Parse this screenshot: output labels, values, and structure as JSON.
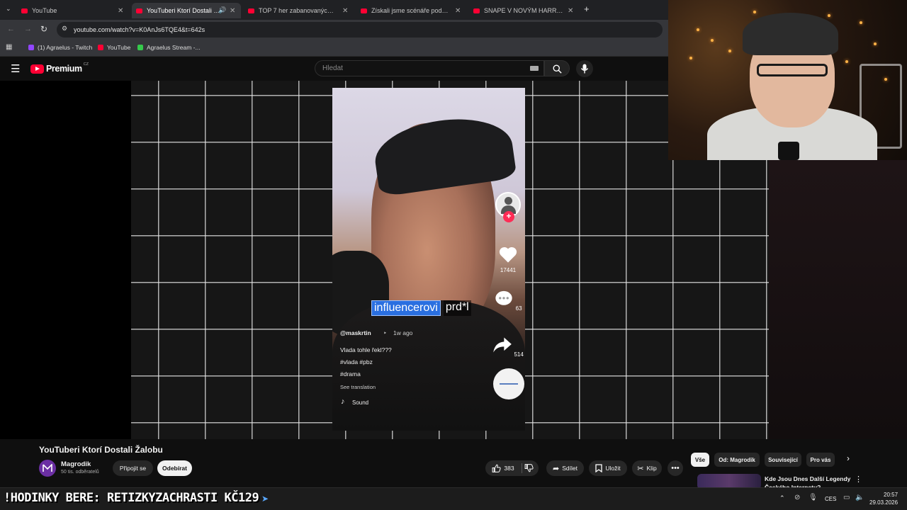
{
  "browser": {
    "tabs": [
      {
        "label": "YouTube",
        "active": false
      },
      {
        "label": "YouTuberi Ktorí Dostali Žalobu",
        "active": true
      },
      {
        "label": "TOP 7 her zabanovaných na Steamu",
        "active": false
      },
      {
        "label": "Získali jsme scénáře podvodníků",
        "active": false
      },
      {
        "label": "SNAPE V NOVÝM HARRY POTTEROVI",
        "active": false
      }
    ],
    "new_tab": "+",
    "url": "youtube.com/watch?v=K0AnJs6TQE4&t=642s",
    "bookmarks": [
      {
        "label": "(1) Agraelus - Twitch",
        "color": "#9146ff"
      },
      {
        "label": "YouTube",
        "color": "#ff0033"
      },
      {
        "label": "Agraelus Stream -...",
        "color": "#35c94b"
      }
    ]
  },
  "youtube": {
    "logo_text": "Premium",
    "logo_region": "CZ",
    "search_placeholder": "Hledat",
    "video": {
      "title": "YouTuberi Ktorí Dostali Žalobu",
      "channel": "Magrodik",
      "subscribers": "50 tis. odběratelů",
      "join_label": "Připojit se",
      "subscribe_label": "Odebírat",
      "likes": "383",
      "share_label": "Sdílet",
      "save_label": "Uložit",
      "clip_label": "Klip"
    },
    "chips": [
      "Vše",
      "Od: Magrodik",
      "Související",
      "Pro vás"
    ],
    "recommended_title": "Kde Jsou Dnes Další Legendy Českého Internetu?"
  },
  "tiktok": {
    "likes": "17441",
    "comments": "63",
    "shares": "514",
    "subtitle_highlight": "influencerovi",
    "subtitle_rest": "prd*l",
    "username": "@maskrtin",
    "posted": "1w ago",
    "caption": "Vlada tohle řekl???",
    "tags1": "#vlada #pbz",
    "tags2": "#drama",
    "see_translation": "See translation",
    "sound": "Sound"
  },
  "overlay": {
    "ticker": "!HODINKY BERE: RETIZKYZACHRASTI KČ129"
  },
  "taskbar": {
    "language": "CES",
    "time": "20:57",
    "date": "29.03.2026"
  },
  "colors": {
    "youtube_red": "#ff0033",
    "highlight_blue": "#2a6fe0",
    "tiktok_pink": "#fe2c55"
  }
}
